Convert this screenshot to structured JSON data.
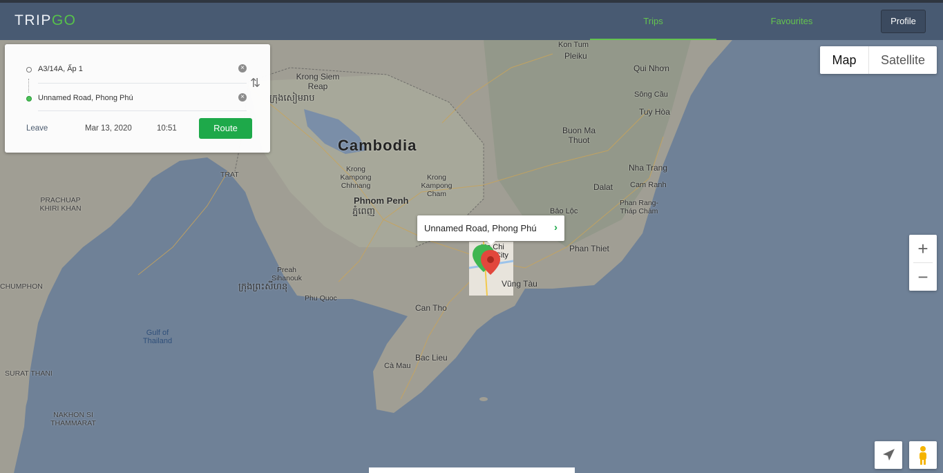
{
  "app": {
    "logo_main": "TRIP",
    "logo_accent": "GO"
  },
  "nav": {
    "trips": "Trips",
    "favourites": "Favourites",
    "profile": "Profile"
  },
  "route_form": {
    "from": "A3/14A,  Ấp 1",
    "to": "Unnamed Road,  Phong Phú",
    "leave_label": "Leave",
    "date": "Mar 13, 2020",
    "time": "10:51",
    "route_button": "Route"
  },
  "map_controls": {
    "map": "Map",
    "satellite": "Satellite",
    "zoom_in": "+",
    "zoom_out": "−"
  },
  "popup": {
    "text": "Unnamed Road, Phong Phú"
  },
  "map_labels": {
    "cambodia": "Cambodia",
    "phnom_penh": "Phnom Penh",
    "phnom_penh_km": "ភ្នំពេញ",
    "krong_siem_reap": "Krong Siem Reap",
    "krong_siem_reap_km": "ក្រុងសៀមរាប",
    "krong_kampong_chhnang": "Krong Kampong Chhnang",
    "krong_kampong_cham": "Krong Kampong Cham",
    "preah_sihanouk": "Preah Sihanouk",
    "preah_sihanouk_km": "ក្រុងព្រះសីហនុ",
    "phu_quoc": "Phu Quoc",
    "can_tho": "Can Tho",
    "bac_lieu": "Bac Lieu",
    "ca_mau": "Cà Mau",
    "vung_tau": "Vũng Tàu",
    "phan_thiet": "Phan Thiet",
    "bao_loc": "Bảo Lộc",
    "dalat": "Dalat",
    "nha_trang": "Nha Trang",
    "cam_ranh": "Cam Ranh",
    "phan_rang": "Phan Rang-Tháp Chàm",
    "buon_ma_thuot": "Buon Ma Thuot",
    "tuy_hoa": "Tuy Hòa",
    "song_cau": "Sông Cầu",
    "qui_nhon": "Qui Nhơn",
    "kon_tum": "Kon Tum",
    "pleiku": "Pleiku",
    "trat": "TRAT",
    "prachuap": "PRACHUAP KHIRI KHAN",
    "chumphon": "CHUMPHON",
    "surat_thani": "SURAT THANI",
    "nakhon": "NAKHON SI THAMMARAT",
    "gulf": "Gulf of Thailand",
    "ho_chi_minh": "Ho Chi Minh City"
  },
  "colors": {
    "header": "#485a72",
    "accent_green": "#64c44f",
    "route_button": "#1ea94a",
    "sea": "#6f8197",
    "land": "#9d9b92"
  }
}
